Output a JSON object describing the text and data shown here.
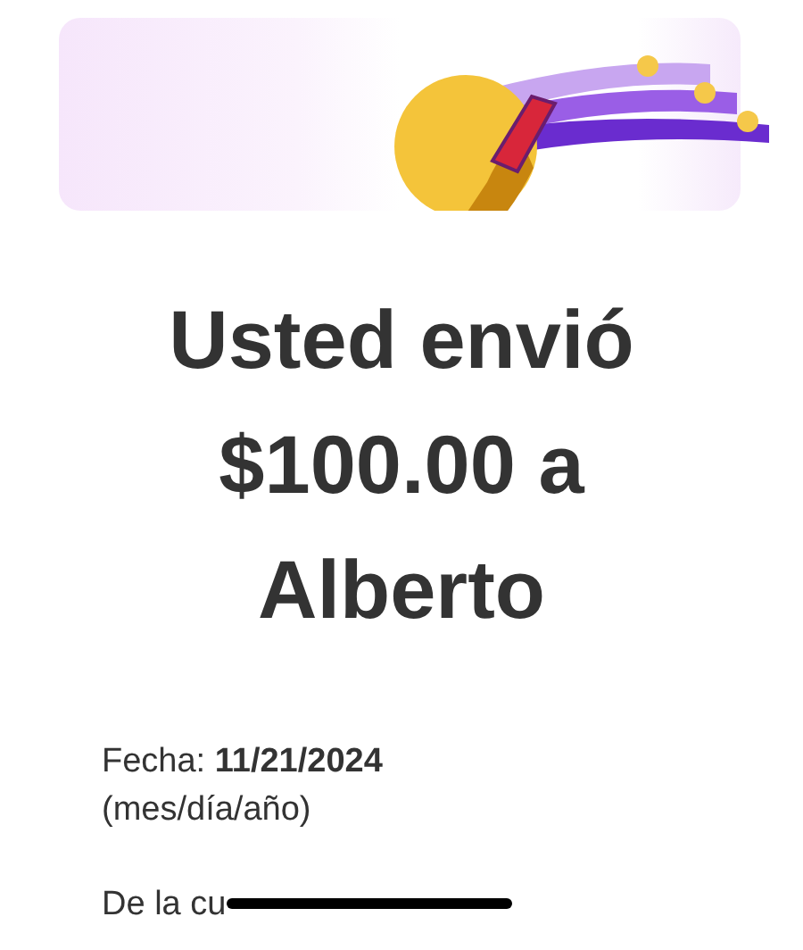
{
  "heading": "Usted envió $100.00 a Alberto",
  "details": [
    {
      "kind": "date",
      "text": "Fecha: **11/21/2024**"
    },
    {
      "kind": "note",
      "text": "(mes/día/año)"
    },
    {
      "kind": "account",
      "text": "De la cu",
      "redacted": true
    }
  ]
}
